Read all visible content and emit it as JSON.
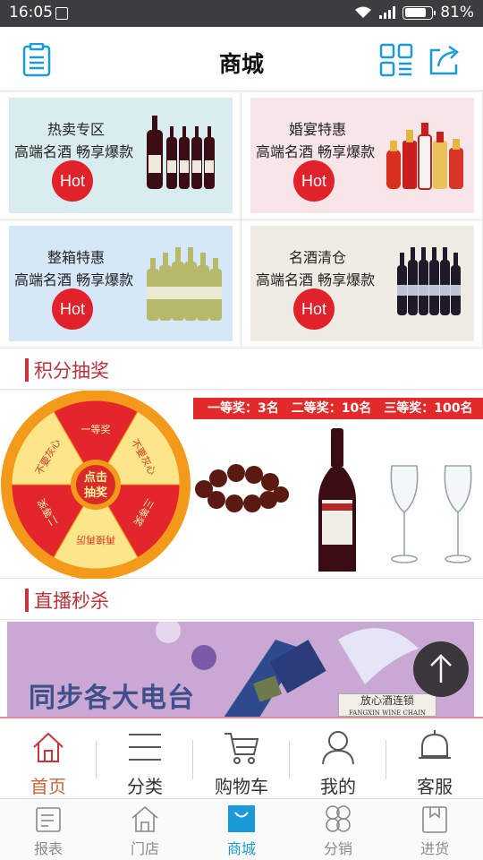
{
  "status_bar": {
    "time": "16:05",
    "battery": "81%",
    "battery_level": 0.81
  },
  "header": {
    "title": "商城",
    "left_icon": "clipboard-icon",
    "qr_icon": "qrcode-icon",
    "share_icon": "share-icon"
  },
  "promo_cards": [
    {
      "title": "热卖专区",
      "subtitle": "高端名酒 畅享爆款",
      "badge": "Hot",
      "bg": "#d9ecef"
    },
    {
      "title": "婚宴特惠",
      "subtitle": "高端名酒 畅享爆款",
      "badge": "Hot",
      "bg": "#f8e5e7"
    },
    {
      "title": "整箱特惠",
      "subtitle": "高端名酒 畅享爆款",
      "badge": "Hot",
      "bg": "#d6e8f8"
    },
    {
      "title": "名酒清仓",
      "subtitle": "高端名酒 畅享爆款",
      "badge": "Hot",
      "bg": "#f1ece3"
    }
  ],
  "lottery_section": {
    "heading": "积分抽奖",
    "prizes": "一等奖：3名　二等奖：10名　三等奖：100名",
    "wheel_center": [
      "点击",
      "抽奖"
    ],
    "wheel_labels": [
      "一等奖",
      "不要灰心",
      "三等奖",
      "再接再厉",
      "二等奖",
      "不要灰心"
    ]
  },
  "live_section": {
    "heading": "直播秒杀",
    "banner_text": "同步各大电台",
    "shop_name": "放心酒连锁",
    "shop_sub": "FANGXIN WINE CHAIN"
  },
  "main_nav": [
    {
      "label": "首页",
      "icon": "home-icon",
      "active": true
    },
    {
      "label": "分类",
      "icon": "menu-icon",
      "active": false
    },
    {
      "label": "购物车",
      "icon": "cart-icon",
      "active": false
    },
    {
      "label": "我的",
      "icon": "user-icon",
      "active": false
    },
    {
      "label": "客服",
      "icon": "bell-icon",
      "active": false
    }
  ],
  "app_nav": [
    {
      "label": "报表",
      "icon": "report-icon",
      "active": false
    },
    {
      "label": "门店",
      "icon": "store-icon",
      "active": false
    },
    {
      "label": "商城",
      "icon": "shopping-bag-icon",
      "active": true
    },
    {
      "label": "分销",
      "icon": "distribution-icon",
      "active": false
    },
    {
      "label": "进货",
      "icon": "purchase-icon",
      "active": false
    }
  ],
  "colors": {
    "accent_red": "#c9343d",
    "hot_red": "#e1222a",
    "active_blue": "#1a9ad8",
    "active_orange": "#c9663a"
  }
}
